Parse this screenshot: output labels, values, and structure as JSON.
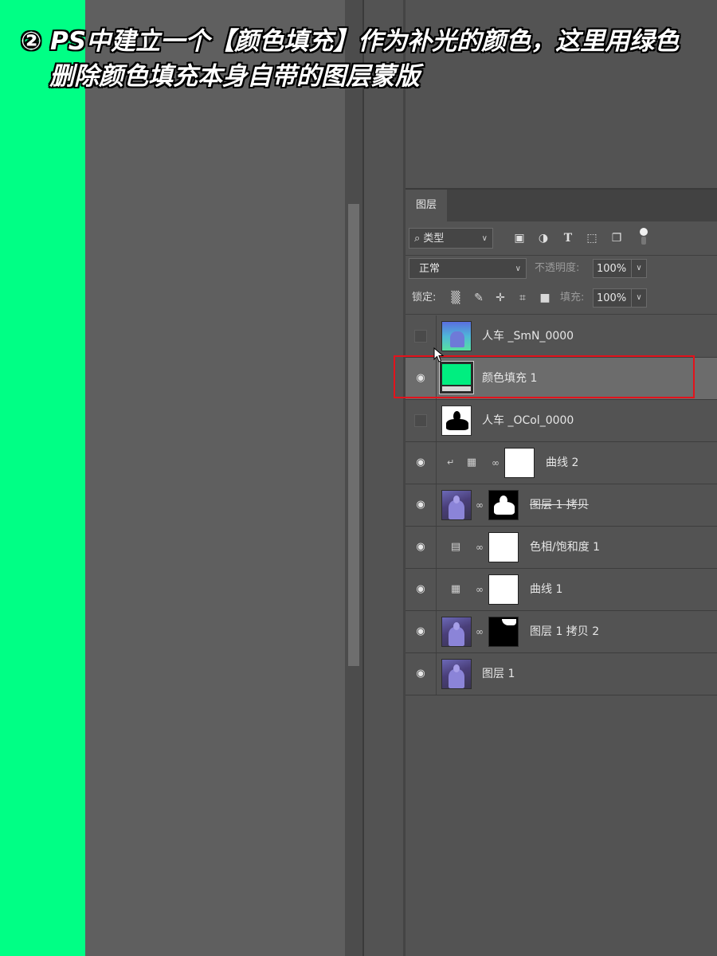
{
  "caption": {
    "line1": "② PS中建立一个【颜色填充】作为补光的颜色，这里用绿色",
    "line2": "删除颜色填充本身自带的图层蒙版"
  },
  "layers_panel": {
    "tab_label": "图层",
    "kind_filter": {
      "label": "类型",
      "search_icon": "search-icon"
    },
    "filter_icons": [
      "image-filter-icon",
      "adjustment-filter-icon",
      "type-filter-icon",
      "shape-filter-icon",
      "smart-object-filter-icon"
    ],
    "blend_mode": "正常",
    "opacity_label": "不透明度:",
    "opacity_value": "100%",
    "lock_label": "锁定:",
    "fill_label": "填充:",
    "fill_value": "100%",
    "layers": [
      {
        "name": "人车 _SmN_0000",
        "visible": false
      },
      {
        "name": "颜色填充 1",
        "visible": true,
        "selected": true
      },
      {
        "name": "人车 _OCol_0000",
        "visible": false
      },
      {
        "name": "曲线 2",
        "visible": true
      },
      {
        "name": "图层 1 拷贝",
        "visible": true
      },
      {
        "name": "色相/饱和度 1",
        "visible": true
      },
      {
        "name": "曲线 1",
        "visible": true
      },
      {
        "name": "图层 1 拷贝 2",
        "visible": true
      },
      {
        "name": "图层 1",
        "visible": true
      }
    ]
  },
  "colors": {
    "fill_green": "#00ff85",
    "highlight_red": "#e3131c"
  }
}
